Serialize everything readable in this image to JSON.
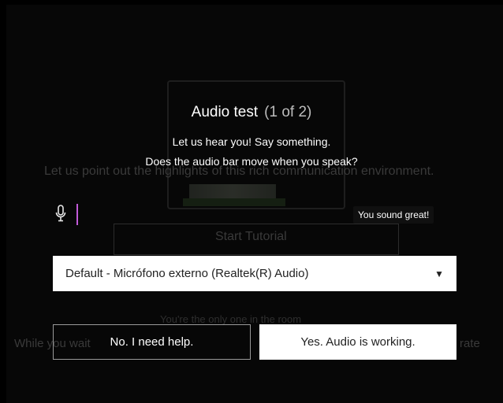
{
  "background": {
    "intro_text": "Let us point out the highlights of this rich communication environment.",
    "start_tutorial": "Start Tutorial",
    "alone_text": "You're the only one in the room",
    "while_text": "While you wait",
    "rate_text": "rate"
  },
  "modal": {
    "title": "Audio test",
    "step": "(1 of 2)",
    "instruction_1": "Let us hear you! Say something.",
    "instruction_2": "Does the audio bar move when you speak?",
    "status": "You sound great!",
    "device_selected": "Default - Micrófono externo (Realtek(R) Audio)",
    "no_button": "No. I need help.",
    "yes_button": "Yes. Audio is working."
  },
  "icons": {
    "mic": "microphone-icon",
    "caret": "caret-down-icon"
  },
  "colors": {
    "audio_bar": "#c25bd9",
    "overlay": "#000000"
  }
}
